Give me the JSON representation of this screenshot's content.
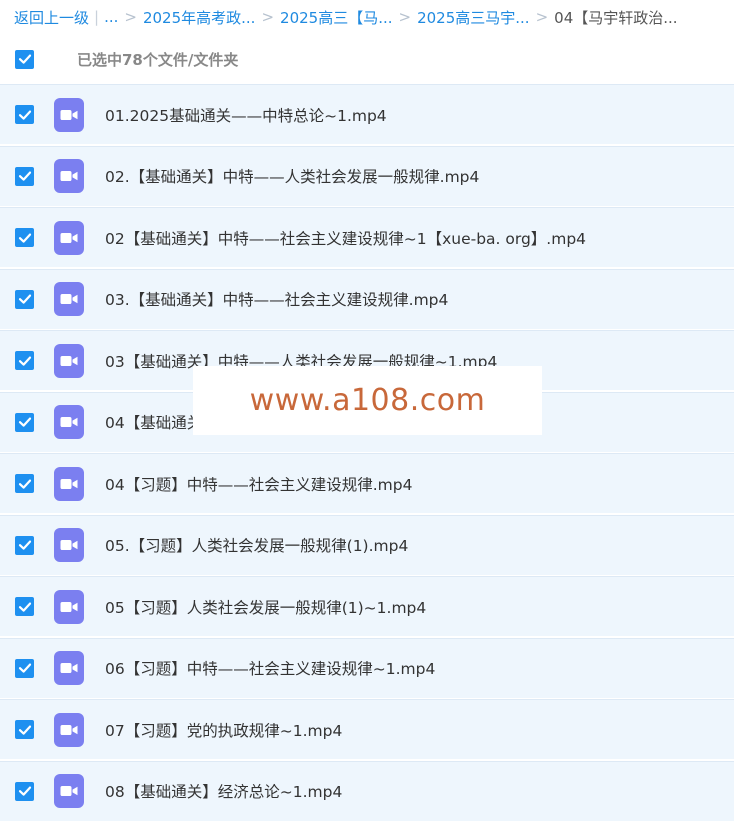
{
  "breadcrumb": {
    "back": "返回上一级",
    "ellipsis": "...",
    "items": [
      "2025年高考政...",
      "2025高三【马...",
      "2025高三马宇...",
      "04【马宇轩政治..."
    ]
  },
  "selection": {
    "label": "已选中78个文件/文件夹"
  },
  "files": [
    "01.2025基础通关——中特总论~1.mp4",
    "02.【基础通关】中特——人类社会发展一般规律.mp4",
    "02【基础通关】中特——社会主义建设规律~1【xue-ba. org】.mp4",
    "03.【基础通关】中特——社会主义建设规律.mp4",
    "03【基础通关】中特——人类社会发展一般规律~1.mp4",
    "04【基础通关】",
    "04【习题】中特——社会主义建设规律.mp4",
    "05.【习题】人类社会发展一般规律(1).mp4",
    "05【习题】人类社会发展一般规律(1)~1.mp4",
    "06【习题】中特——社会主义建设规律~1.mp4",
    "07【习题】党的执政规律~1.mp4",
    "08【基础通关】经济总论~1.mp4"
  ],
  "watermark": "www.a108.com",
  "colors": {
    "link": "#1f8ae0",
    "checkbox": "#1e90f0",
    "video_icon": "#7b7ff0",
    "row_bg": "#eef6fd",
    "watermark": "#c8683a"
  }
}
